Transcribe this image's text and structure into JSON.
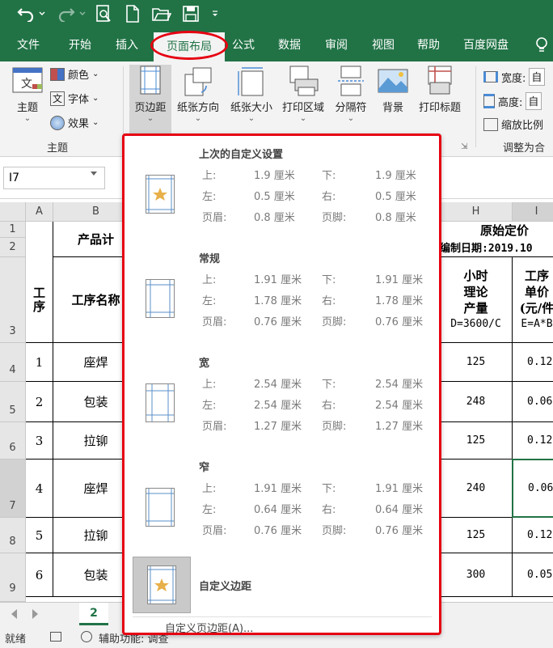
{
  "quick_access": {
    "undo_icon": "undo-icon",
    "redo_icon": "redo-icon",
    "print_preview_icon": "print-preview-icon",
    "new_icon": "new-file-icon",
    "open_icon": "open-folder-icon",
    "save_icon": "save-icon",
    "customize_icon": "caret-down-icon"
  },
  "tabs": [
    "文件",
    "开始",
    "插入",
    "页面布局",
    "公式",
    "数据",
    "审阅",
    "视图",
    "帮助",
    "百度网盘"
  ],
  "active_tab": "页面布局",
  "ribbon": {
    "theme_group": {
      "theme_label": "主题",
      "colors_label": "颜色",
      "fonts_label": "字体",
      "effects_label": "效果",
      "group_label": "主题"
    },
    "page_setup": {
      "margins_label": "页边距",
      "orientation_label": "纸张方向",
      "size_label": "纸张大小",
      "print_area_label": "打印区域",
      "breaks_label": "分隔符",
      "background_label": "背景",
      "print_titles_label": "打印标题"
    },
    "scale_group": {
      "width_label": "宽度:",
      "width_value": "自",
      "height_label": "高度:",
      "height_value": "自",
      "scale_label": "缩放比例",
      "group_label": "调整为合"
    }
  },
  "namebox": "I7",
  "columns": [
    "A",
    "B",
    "H",
    "I"
  ],
  "rows": [
    "1",
    "2",
    "3",
    "4",
    "5",
    "6",
    "7",
    "8",
    "9"
  ],
  "sheet": {
    "product_header": "产品计",
    "original_price": "原始定价",
    "compile_date": "编制日期:2019.10",
    "col_proc_no": "工序",
    "col_proc_name": "工序名称",
    "col_hour": "小时",
    "col_theory": "理论",
    "col_output": "产量",
    "col_formula_d": "D=3600/C",
    "col_unit1": "工序",
    "col_unit2": "单价",
    "col_unit3": "(元/件",
    "col_formula_e": "E=A*B",
    "data": [
      {
        "no": "1",
        "name": "座焊",
        "h": "125",
        "i": "0.12"
      },
      {
        "no": "2",
        "name": "包装",
        "h": "248",
        "i": "0.06"
      },
      {
        "no": "3",
        "name": "拉铆",
        "h": "125",
        "i": "0.12"
      },
      {
        "no": "4",
        "name": "座焊",
        "h": "240",
        "i": "0.06"
      },
      {
        "no": "5",
        "name": "拉铆",
        "h": "125",
        "i": "0.12"
      },
      {
        "no": "6",
        "name": "包装",
        "h": "300",
        "i": "0.05"
      }
    ]
  },
  "sheet_tab": "2",
  "status": {
    "ready": "就绪",
    "accessibility": "辅助功能: 调查"
  },
  "margins_menu": {
    "presets": [
      {
        "title": "上次的自定义设置",
        "top_label": "上:",
        "top": "1.9 厘米",
        "bottom_label": "下:",
        "bottom": "1.9 厘米",
        "left_label": "左:",
        "left": "0.5 厘米",
        "right_label": "右:",
        "right": "0.5 厘米",
        "header_label": "页眉:",
        "header": "0.8 厘米",
        "footer_label": "页脚:",
        "footer": "0.8 厘米"
      },
      {
        "title": "常规",
        "top_label": "上:",
        "top": "1.91 厘米",
        "bottom_label": "下:",
        "bottom": "1.91 厘米",
        "left_label": "左:",
        "left": "1.78 厘米",
        "right_label": "右:",
        "right": "1.78 厘米",
        "header_label": "页眉:",
        "header": "0.76 厘米",
        "footer_label": "页脚:",
        "footer": "0.76 厘米"
      },
      {
        "title": "宽",
        "top_label": "上:",
        "top": "2.54 厘米",
        "bottom_label": "下:",
        "bottom": "2.54 厘米",
        "left_label": "左:",
        "left": "2.54 厘米",
        "right_label": "右:",
        "right": "2.54 厘米",
        "header_label": "页眉:",
        "header": "1.27 厘米",
        "footer_label": "页脚:",
        "footer": "1.27 厘米"
      },
      {
        "title": "窄",
        "top_label": "上:",
        "top": "1.91 厘米",
        "bottom_label": "下:",
        "bottom": "1.91 厘米",
        "left_label": "左:",
        "left": "0.64 厘米",
        "right_label": "右:",
        "right": "0.64 厘米",
        "header_label": "页眉:",
        "header": "0.76 厘米",
        "footer_label": "页脚:",
        "footer": "0.76 厘米"
      }
    ],
    "custom_margins_title": "自定义边距",
    "custom_margins_link": "自定义页边距(A)..."
  },
  "colors": {
    "excel_green": "#217346",
    "highlight_red": "#e60012",
    "star": "#e8b04a"
  }
}
